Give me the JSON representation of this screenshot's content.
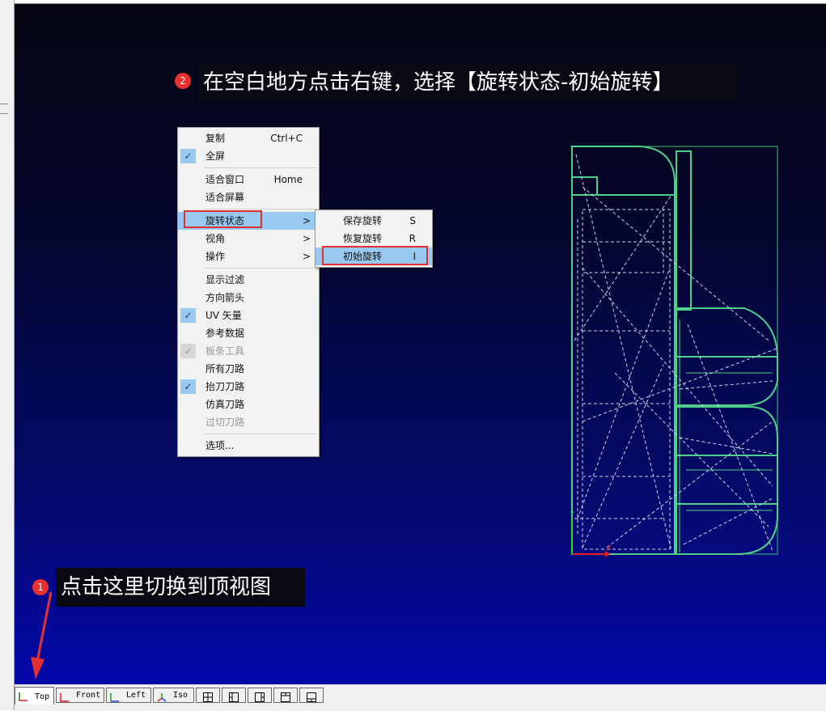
{
  "callouts": {
    "step2_badge": "2",
    "step2_text": "在空白地方点击右键，选择【旋转状态-初始旋转】",
    "step1_badge": "1",
    "step1_text": "点击这里切换到顶视图"
  },
  "context_menu": {
    "items": [
      {
        "label": "复制",
        "shortcut": "Ctrl+C"
      },
      {
        "label": "全屏",
        "checked": true
      },
      {
        "label": "适合窗口",
        "shortcut": "Home"
      },
      {
        "label": "适合屏幕"
      },
      {
        "label": "旋转状态",
        "submenu": true,
        "highlighted": true
      },
      {
        "label": "视角",
        "submenu": true
      },
      {
        "label": "操作",
        "submenu": true
      },
      {
        "label": "显示过滤"
      },
      {
        "label": "方向箭头"
      },
      {
        "label": "UV 矢量",
        "checked": true
      },
      {
        "label": "参考数据"
      },
      {
        "label": "板条工具",
        "checked": true,
        "disabled": true
      },
      {
        "label": "所有刀路"
      },
      {
        "label": "抬刀刀路",
        "checked": true
      },
      {
        "label": "仿真刀路"
      },
      {
        "label": "过切刀路",
        "disabled": true
      },
      {
        "label": "选项..."
      }
    ],
    "arrow_glyph": ">",
    "check_glyph": "✓"
  },
  "submenu": {
    "items": [
      {
        "label": "保存旋转",
        "shortcut": "S"
      },
      {
        "label": "恢复旋转",
        "shortcut": "R"
      },
      {
        "label": "初始旋转",
        "shortcut": "I"
      }
    ]
  },
  "view_tabs": {
    "tabs": [
      {
        "label": "Top",
        "active": true,
        "icon": "top-axis-icon"
      },
      {
        "label": "Front",
        "icon": "front-axis-icon"
      },
      {
        "label": "Left",
        "icon": "left-axis-icon"
      },
      {
        "label": "Iso",
        "icon": "iso-axis-icon"
      }
    ],
    "layout_buttons": [
      "layout-quad-icon",
      "layout-left-split-icon",
      "layout-right-split-icon",
      "layout-top-split-icon",
      "layout-bottom-split-icon"
    ]
  },
  "colors": {
    "callout_badge": "#e83030",
    "highlight_box": "#e03030",
    "menu_highlight": "#99c9f0",
    "model_lines": "#4fd08a",
    "viewport_bottom": "#0208a8"
  }
}
